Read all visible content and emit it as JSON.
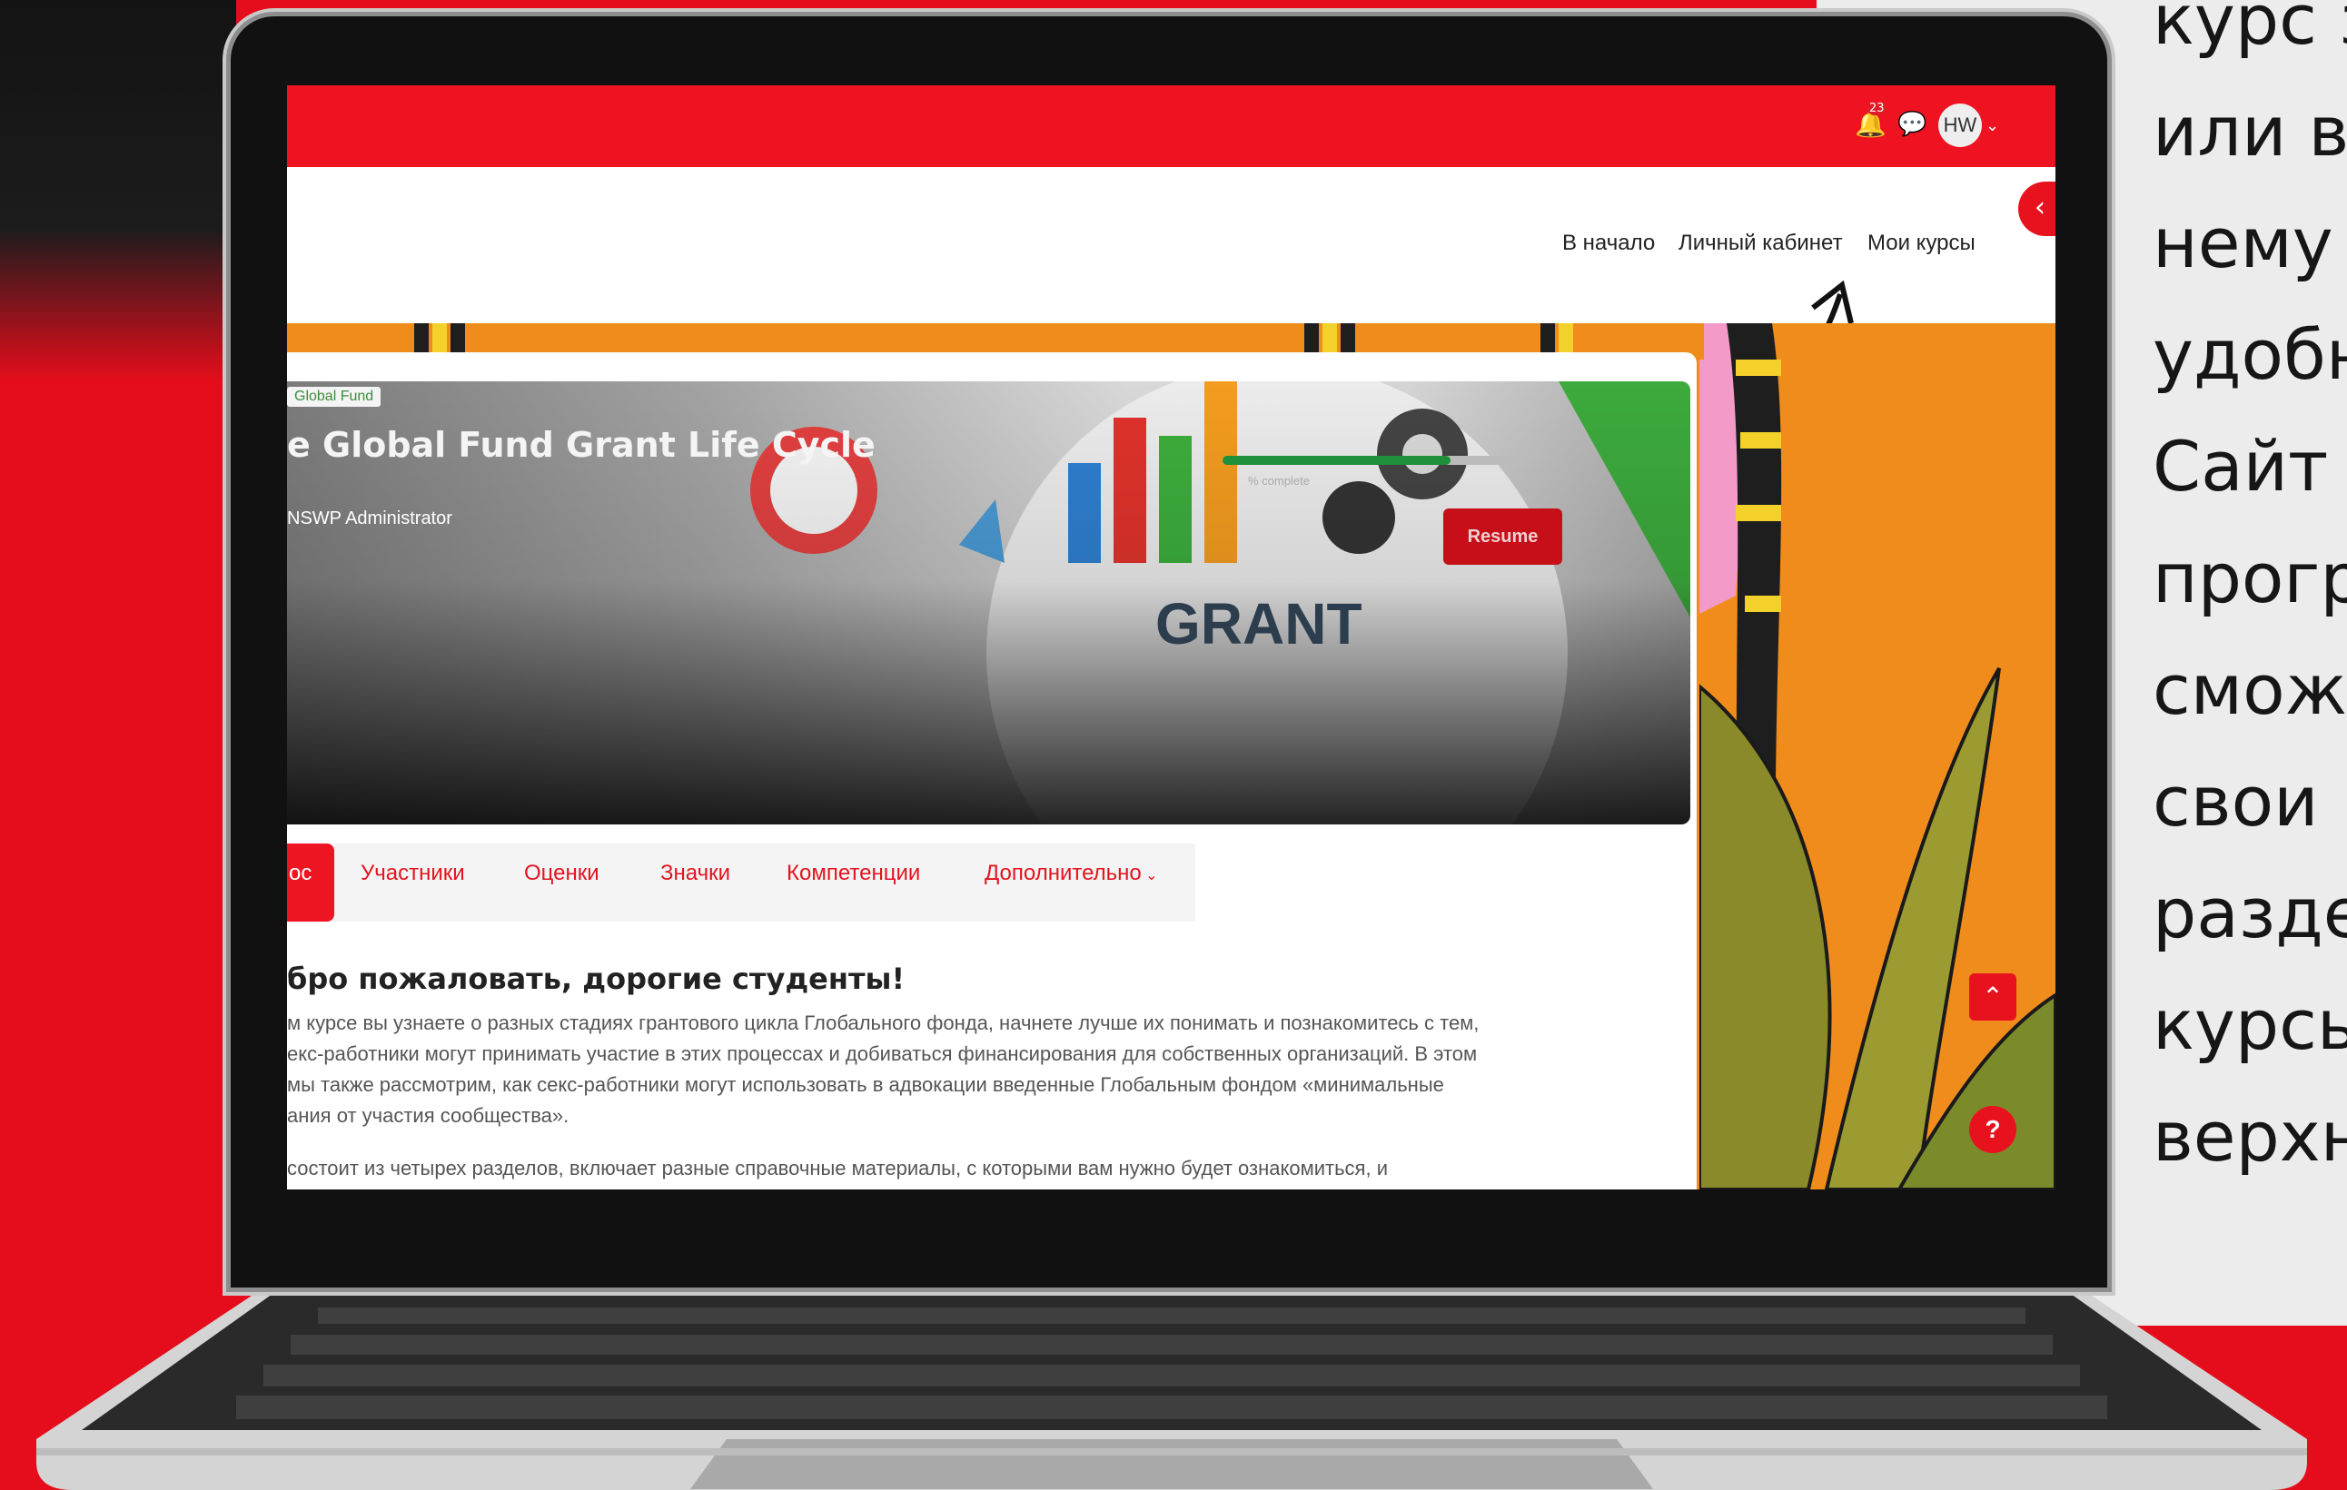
{
  "topbar": {
    "notification_count": "23",
    "avatar_initials": "HW"
  },
  "nav": {
    "home": "В начало",
    "dashboard": "Личный кабинет",
    "my_courses": "Мои курсы"
  },
  "course": {
    "category": "Global Fund",
    "title": "e Global Fund Grant Life Cycle",
    "teacher": "NSWP Administrator",
    "progress_label": "% complete",
    "progress_value": 0.75,
    "resume_label": "Resume",
    "hero_word": "GRANT"
  },
  "tabs": [
    "ос",
    "Участники",
    "Оценки",
    "Значки",
    "Компетенции",
    "Дополнительно"
  ],
  "welcome": "бро пожаловать, дорогие студенты!",
  "paragraph1": [
    "м курсе вы узнаете о разных стадиях грантового цикла Глобального фонда, начнете лучше их понимать и познакомитесь с тем,",
    "екс-работники могут принимать участие в этих процессах и добиваться финансирования для собственных организаций. В этом",
    "мы также рассмотрим, как секс-работники могут использовать в адвокации введенные Глобальным фондом «минимальные",
    "ания от участия сообщества»."
  ],
  "paragraph2": "состоит из четырех разделов, включает разные справочные материалы, с которыми вам нужно будет ознакомиться, и",
  "side_text": [
    "курс з",
    "или в",
    "нему",
    "удобн",
    "Сайт",
    "прогр",
    "смож",
    "свои",
    "разде",
    "курсы",
    "верхн"
  ],
  "colors": {
    "brand_red": "#ef1321",
    "orange": "#ef8a1f"
  }
}
